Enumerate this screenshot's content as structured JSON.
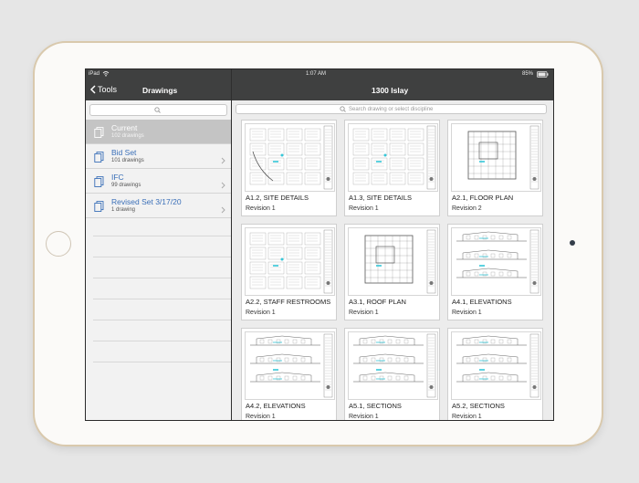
{
  "status": {
    "carrier": "iPad",
    "time": "1:07 AM",
    "battery": "85%"
  },
  "left_nav": {
    "back_label": "Tools",
    "title": "Drawings"
  },
  "right_nav": {
    "title": "1300 Islay"
  },
  "search": {
    "placeholder": "Search drawing or select discipline"
  },
  "sets": [
    {
      "label": "Current",
      "sub": "102 drawings",
      "active": true
    },
    {
      "label": "Bid Set",
      "sub": "101 drawings"
    },
    {
      "label": "IFC",
      "sub": "99 drawings"
    },
    {
      "label": "Revised Set 3/17/20",
      "sub": "1 drawing"
    }
  ],
  "drawings": [
    {
      "name": "A1.2, SITE DETAILS",
      "rev": "Revision 1",
      "kind": "site"
    },
    {
      "name": "A1.3, SITE DETAILS",
      "rev": "Revision 1",
      "kind": "site2"
    },
    {
      "name": "A2.1, FLOOR PLAN",
      "rev": "Revision 2",
      "kind": "floor"
    },
    {
      "name": "A2.2, STAFF RESTROOMS",
      "rev": "Revision 1",
      "kind": "rest"
    },
    {
      "name": "A3.1, ROOF PLAN",
      "rev": "Revision 1",
      "kind": "roof"
    },
    {
      "name": "A4.1, ELEVATIONS",
      "rev": "Revision 1",
      "kind": "elev"
    },
    {
      "name": "A4.2, ELEVATIONS",
      "rev": "Revision 1",
      "kind": "elev2"
    },
    {
      "name": "A5.1, SECTIONS",
      "rev": "Revision 1",
      "kind": "sect"
    },
    {
      "name": "A5.2, SECTIONS",
      "rev": "Revision 1",
      "kind": "sect2"
    }
  ],
  "colors": {
    "bar": "#3f4040",
    "link": "#3a6fb8",
    "active": "#c4c4c4",
    "markup": "#35c7d8"
  }
}
